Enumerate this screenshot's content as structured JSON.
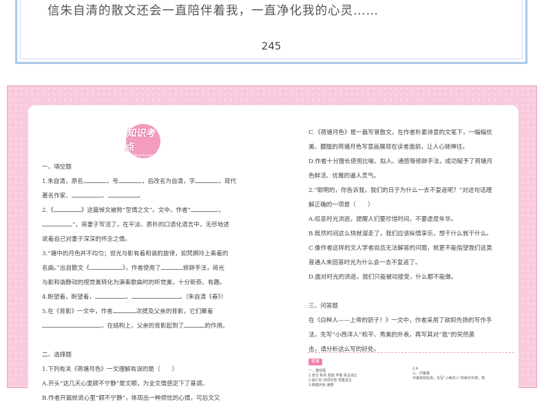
{
  "top_page": {
    "text": "信朱自清的散文还会一直陪伴着我，一直净化我的心灵……",
    "page_number": "245"
  },
  "badge": {
    "title": "知识考点",
    "subtitle": "Zhishi Kaodian"
  },
  "left": {
    "section1": "一、填空题",
    "q1a": "1.朱自清，原名",
    "q1b": "，号",
    "q1c": "，后改名为自清，字",
    "q1d": "，现代",
    "q1e": "著名作家、",
    "q1f": "、",
    "q1g": "。",
    "q2a": "2.《",
    "q2b": "》这篇悼文被称“至情之文”。文中，作者“",
    "q2c": "，",
    "q2d": "”，将妻子写活了，在平淡、质朴的口语化语言中，无尽地述",
    "q2e": "说着自己对妻子深深的怀念之情。",
    "q3a": "3.“塘中的月色并不均匀；但光与影有着和谐的旋律，如梵婀玲上奏着的",
    "q3b": "名曲。”出自散文《",
    "q3c": "》，作者使用了",
    "q3d": "修辞手法，将光",
    "q3e": "与影和谐静动的视觉美转化为演奏歌曲时的听觉美，十分新奇、有趣。",
    "q4a": "4.盼望着，盼望着，",
    "q4b": "，",
    "q4c": "。（朱自清《春》）",
    "q5a": "5.在《背影》一文中，作者",
    "q5b": "次提及父亲的背影，它们聚着",
    "q5c": "，在结构上，父亲的背影起到了",
    "q5d": "的作用。",
    "section2": "二、选择题",
    "c1": "1.下列有关《荷塘月色》一文理解有误的是（　　）",
    "c1a": "A.开头“这几天心里颇不宁静”是文眼，为全文情感定下了基调。",
    "c1b": "B.作者开篇就说心里“颇不宁静”，体现出一种烦忧的心情，可后文又"
  },
  "right": {
    "r1": "C.《荷塘月色》是一篇写景散文，在作者朴素诗意的文笔下，一幅幅优",
    "r2": "美、朦胧的荷塘月色写意画展现在读者面前，让人心驰神往。",
    "r3": "D.作者十分擅长使用比喻、拟人、通感等修辞手法，成功赋予了荷塘月",
    "r4": "色鲜活、优雅的逼人灵气。",
    "r5": "2.“聪明的，你告诉我，我们的日子为什么一去不复返呢？”对这句话理",
    "r6": "解正确的一项是（　　）",
    "r7": "A.叹息时光流逝，提醒人们要珍惜时间，不要虚度年华。",
    "r8": "B.既然时间这么快就溜走了，我们应该纵情享乐，想干什么就干什么。",
    "r9": "C.像作者这样的文人学者尚且无法解答的问题，就更不能指望我们这类",
    "r10": "普通人来回答时光为什么会一去不复返了。",
    "r11": "D.面对时光的流逝，我们只能被动接受，什么都不能做。",
    "section3": "三、问答题",
    "r12": "在《白种人——上帝的骄子！》一文中，作者采用了欲抑先扬的写作手",
    "r13": "法，先写“小西洋人”和平、秀美的外表，再写其对“我”的突然袭",
    "r14": "击，请分析这么写的好处。"
  },
  "answers": {
    "label": "答案",
    "a1": "一、填空题",
    "a2": "1.自华  秋实  佩弦  学者  民主战士",
    "a3": "2.给亡妇  对同甘苦  情重且生",
    "a4": "3.荷塘月色  通感",
    "b1": "2.A",
    "b2": "三、问答题",
    "b3": "作者欲抑先扬，先写“小西洋人”的和平外表，表"
  }
}
